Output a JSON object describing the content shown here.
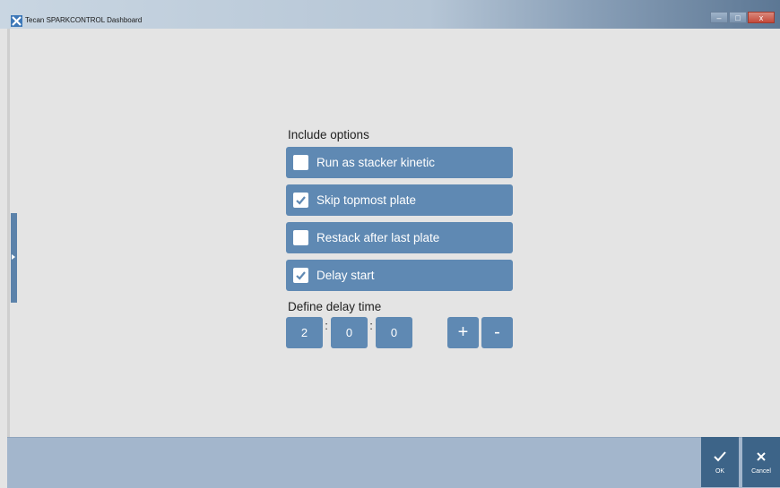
{
  "window": {
    "title": "Tecan SPARKCONTROL Dashboard",
    "minimize_glyph": "–",
    "maximize_glyph": "□",
    "close_glyph": "x"
  },
  "include_options": {
    "heading": "Include options",
    "items": [
      {
        "label": "Run as stacker kinetic",
        "checked": false
      },
      {
        "label": "Skip topmost plate",
        "checked": true
      },
      {
        "label": "Restack after last plate",
        "checked": false
      },
      {
        "label": "Delay start",
        "checked": true
      }
    ]
  },
  "delay_time": {
    "heading": "Define delay time",
    "hours": "2",
    "minutes": "0",
    "seconds": "0",
    "separator": ":",
    "increment_label": "+",
    "decrement_label": "-"
  },
  "actions": {
    "ok_label": "OK",
    "cancel_label": "Cancel"
  },
  "colors": {
    "option_bg": "#5f89b3",
    "bottom_bar": "#a3b6cc",
    "action_button": "#3d6488",
    "check_mark": "#5f89b3"
  },
  "icons": {
    "app": "tecan-x-icon",
    "checkmark": "checkmark-icon",
    "ok": "checkmark-icon",
    "cancel": "close-icon",
    "side_handle": "chevron-right-icon"
  }
}
